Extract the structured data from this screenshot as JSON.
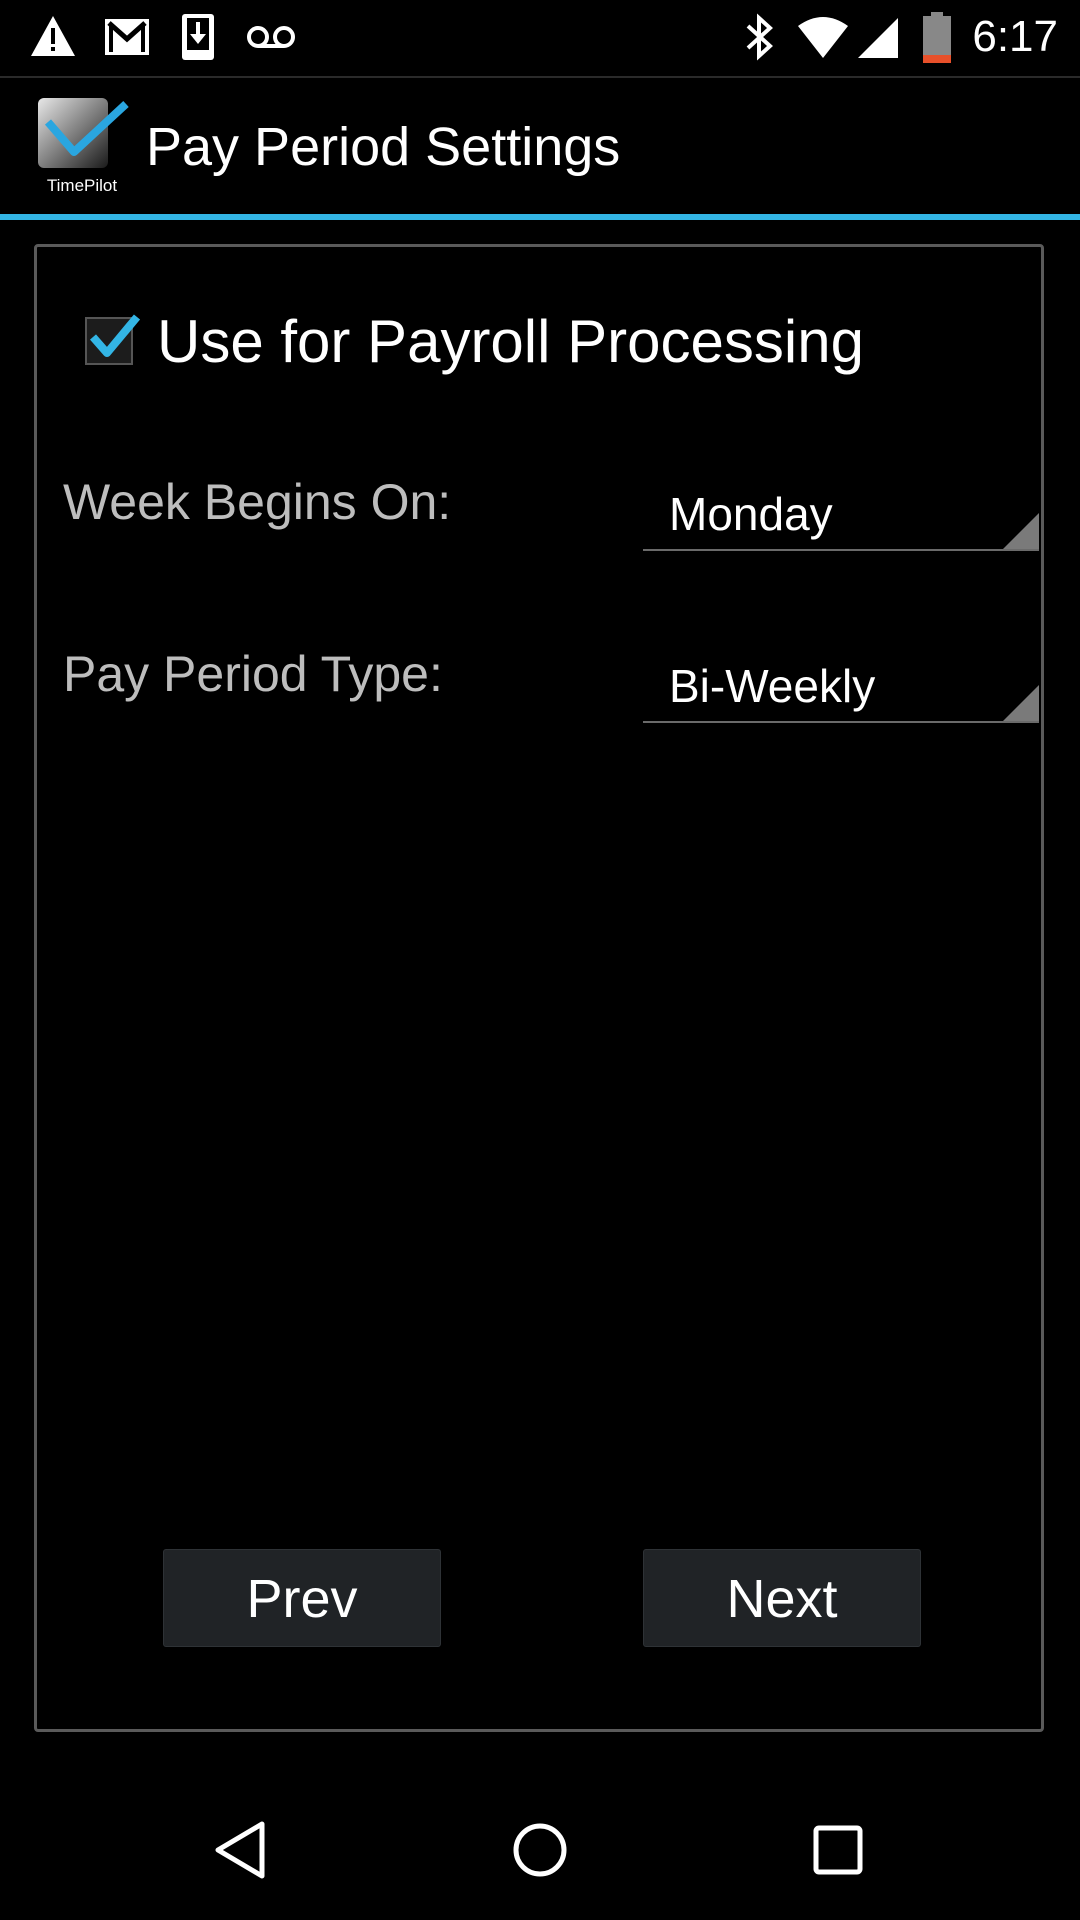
{
  "status_bar": {
    "icons_left": [
      "warning-icon",
      "gmail-icon",
      "download-icon",
      "voicemail-icon"
    ],
    "icons_right": [
      "bluetooth-icon",
      "wifi-icon",
      "signal-icon",
      "battery-icon"
    ],
    "time": "6:17"
  },
  "action_bar": {
    "logo_text": "TimePilot",
    "title": "Pay Period Settings",
    "accent_color": "#33b5e5"
  },
  "form": {
    "payroll_checkbox": {
      "label": "Use for Payroll Processing",
      "checked": true
    },
    "week_begins": {
      "label": "Week Begins On:",
      "value": "Monday"
    },
    "pay_period_type": {
      "label": "Pay Period Type:",
      "value": "Bi-Weekly"
    }
  },
  "buttons": {
    "prev": "Prev",
    "next": "Next"
  },
  "nav_bar": {
    "icons": [
      "back-icon",
      "home-icon",
      "recents-icon"
    ]
  }
}
